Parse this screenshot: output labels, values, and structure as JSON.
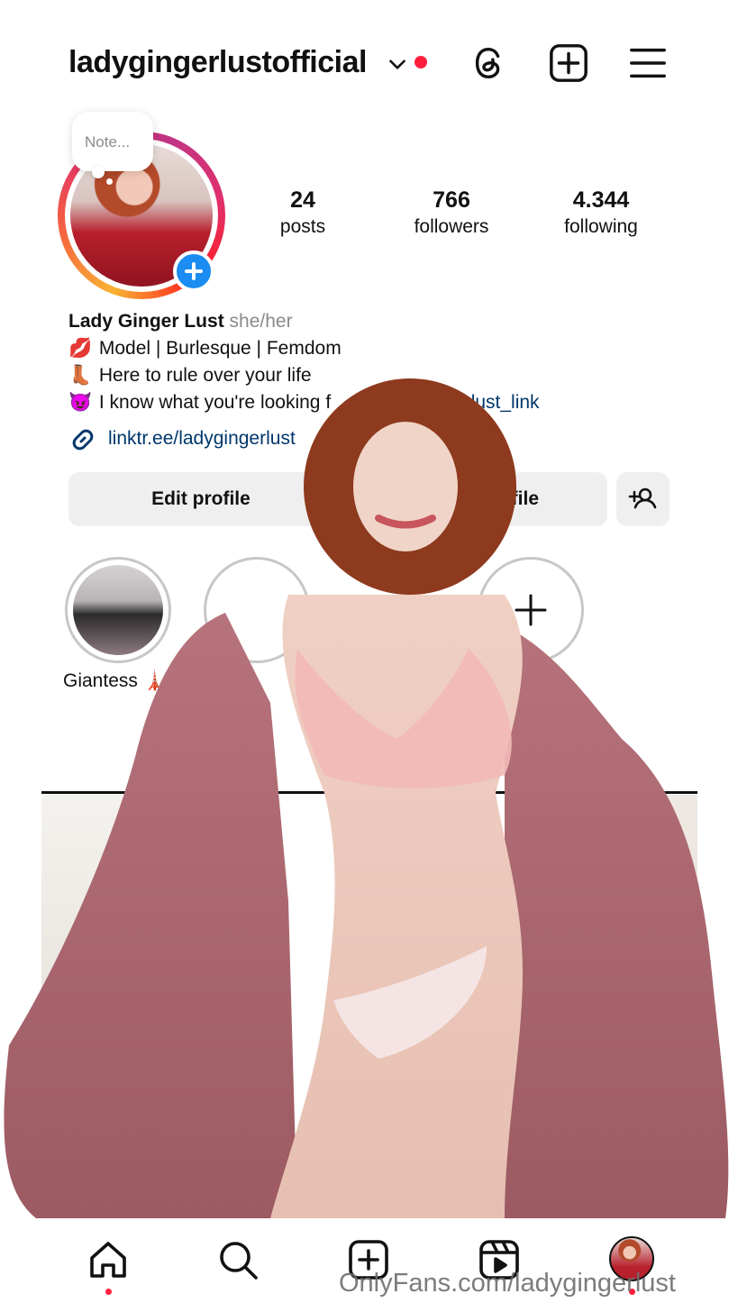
{
  "header": {
    "username": "ladygingerlustofficial",
    "icons": [
      "chevron-down-icon",
      "threads-icon",
      "create-plus-icon",
      "menu-icon"
    ]
  },
  "note": {
    "placeholder": "Note..."
  },
  "stats": [
    {
      "value": "24",
      "label": "posts"
    },
    {
      "value": "766",
      "label": "followers"
    },
    {
      "value": "4.344",
      "label": "following"
    }
  ],
  "bio": {
    "name": "Lady Ginger Lust",
    "pronouns": "she/her",
    "lines": [
      {
        "emoji": "💋",
        "text": "Model | Burlesque | Femdom"
      },
      {
        "emoji": "👢",
        "text": "Here to rule over your life"
      },
      {
        "emoji": "😈",
        "text": "I know what you're looking f",
        "mention": "@gingerlust_link"
      }
    ],
    "link": "linktr.ee/ladygingerlust"
  },
  "buttons": {
    "edit_profile": "Edit profile",
    "share_profile": "file"
  },
  "highlights": [
    {
      "label": "Giantess 🗼"
    }
  ],
  "nav": {
    "items": [
      "home-icon",
      "search-icon",
      "create-icon",
      "reels-icon",
      "profile-avatar"
    ]
  },
  "watermark": "OnlyFans.com/ladygingerlust",
  "colors": {
    "notification_red": "#ff1f3d",
    "link_blue": "#00376b",
    "badge_blue": "#1a8cf2",
    "button_gray": "#efefef"
  }
}
